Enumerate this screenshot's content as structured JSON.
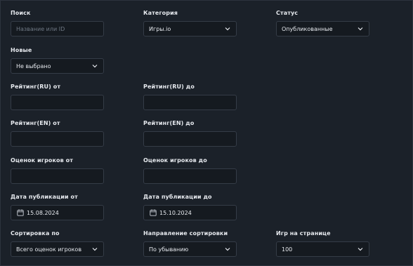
{
  "filters": {
    "search": {
      "label": "Поиск",
      "placeholder": "Название или ID",
      "value": ""
    },
    "category": {
      "label": "Категория",
      "value": "Игры.io"
    },
    "status": {
      "label": "Статус",
      "value": "Опубликованные"
    },
    "new": {
      "label": "Новые",
      "value": "Не выбрано"
    },
    "rating_ru_from": {
      "label": "Рейтинг(RU) от",
      "value": ""
    },
    "rating_ru_to": {
      "label": "Рейтинг(RU) до",
      "value": ""
    },
    "rating_en_from": {
      "label": "Рейтинг(EN) от",
      "value": ""
    },
    "rating_en_to": {
      "label": "Рейтинг(EN) до",
      "value": ""
    },
    "votes_from": {
      "label": "Оценок игроков от",
      "value": ""
    },
    "votes_to": {
      "label": "Оценок игроков до",
      "value": ""
    },
    "pub_from": {
      "label": "Дата публикации от",
      "value": "15.08.2024",
      "icon": "calendar-icon"
    },
    "pub_to": {
      "label": "Дата публикации до",
      "value": "15.10.2024",
      "icon": "calendar-icon"
    },
    "sort_by": {
      "label": "Сортировка по",
      "value": "Всего оценок игроков"
    },
    "sort_dir": {
      "label": "Направление сортировки",
      "value": "По убыванию"
    },
    "per_page": {
      "label": "Игр на странице",
      "value": "100"
    }
  },
  "colors": {
    "background": "#1b2129",
    "input_bg": "#151a20",
    "border": "#353c47",
    "text": "#e6e9ee",
    "placeholder": "#6f7884"
  }
}
